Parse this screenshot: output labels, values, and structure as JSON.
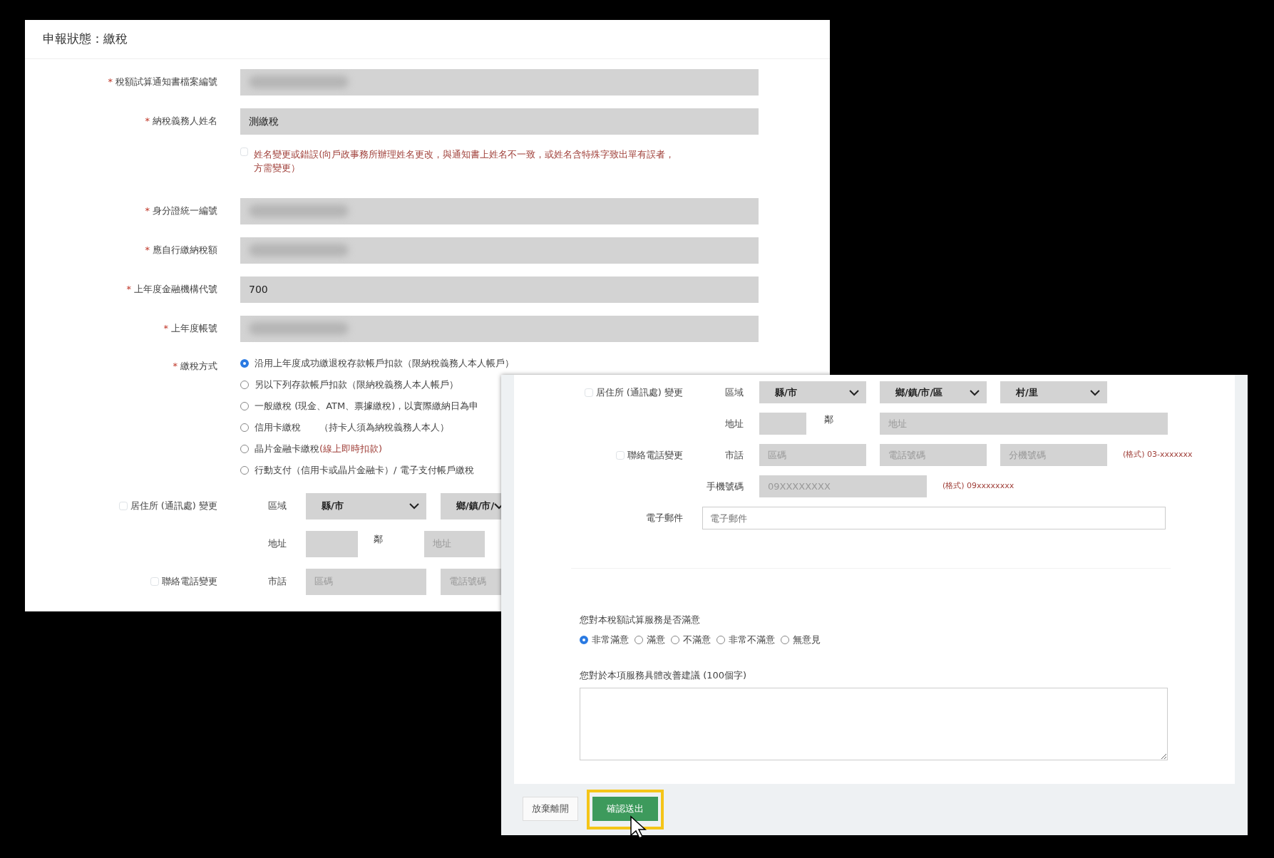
{
  "back_window": {
    "title": "申報狀態：繳稅",
    "fields": [
      {
        "mark": "*",
        "label": "稅額試算通知書檔案編號",
        "kind": "redacted"
      },
      {
        "mark": "*",
        "label": "納稅義務人姓名",
        "kind": "text",
        "value": "測繳稅"
      },
      {
        "kind": "checkbox",
        "label": "姓名變更或錯誤(向戶政事務所辦理姓名更改，與通知書上姓名不一致，或姓名含特殊字致出單有誤者，方需變更）",
        "checked": false
      },
      {
        "mark": "*",
        "label": "身分證統一編號",
        "kind": "redacted"
      },
      {
        "mark": "*",
        "label": "應自行繳納稅額",
        "kind": "redacted"
      },
      {
        "mark": "*",
        "label": "上年度金融機構代號",
        "kind": "text",
        "value": "700"
      },
      {
        "mark": "*",
        "label": "上年度帳號",
        "kind": "redacted"
      }
    ],
    "payment": {
      "mark": "*",
      "label": "繳稅方式",
      "options": [
        {
          "label": "沿用上年度成功繳退稅存款帳戶扣款（限納稅義務人本人帳戶）",
          "selected": true
        },
        {
          "label": "另以下列存款帳戶扣款（限納稅義務人本人帳戶）",
          "selected": false
        },
        {
          "label": "一般繳稅 (現金、ATM、票據繳稅)，以實際繳納日為申",
          "selected": false
        },
        {
          "label": "信用卡繳稅　　（持卡人須為納稅義務人本人）",
          "selected": false
        },
        {
          "label": "晶片金融卡繳稅",
          "note": "(線上即時扣款)",
          "selected": false
        },
        {
          "label": "行動支付（信用卡或晶片金融卡）/ 電子支付帳戶繳稅",
          "selected": false
        }
      ]
    },
    "residence": {
      "label": "居住所 (通訊處) 變更",
      "checked": false,
      "area_label": "區域",
      "selects": [
        "縣/市",
        "鄉/鎮/市/"
      ],
      "address_label": "地址",
      "neighbor": "鄰",
      "address_placeholder": "地址"
    },
    "phone": {
      "label": "聯絡電話變更",
      "checked": false,
      "landline_label": "市話",
      "placeholders": [
        "區碼",
        "電話號碼"
      ]
    }
  },
  "front_window": {
    "residence": {
      "label": "居住所 (通訊處) 變更",
      "checked": false,
      "area_label": "區域",
      "selects": [
        "縣/市",
        "鄉/鎮/市/區",
        "村/里"
      ],
      "address_label": "地址",
      "neighbor": "鄰",
      "address_placeholder": "地址"
    },
    "phone": {
      "label": "聯絡電話變更",
      "checked": false,
      "landline_label": "市話",
      "placeholders": [
        "區碼",
        "電話號碼",
        "分機號碼"
      ],
      "landline_hint": "(格式) 03-xxxxxxx",
      "mobile_label": "手機號碼",
      "mobile_placeholder": "09XXXXXXXX",
      "mobile_hint": "(格式) 09xxxxxxxx"
    },
    "email": {
      "label": "電子郵件",
      "placeholder": "電子郵件"
    },
    "survey": {
      "question": "您對本稅額試算服務是否滿意",
      "options": [
        {
          "label": "非常滿意",
          "selected": true
        },
        {
          "label": "滿意",
          "selected": false
        },
        {
          "label": "不滿意",
          "selected": false
        },
        {
          "label": "非常不滿意",
          "selected": false
        },
        {
          "label": "無意見",
          "selected": false
        }
      ]
    },
    "suggestion": {
      "label": "您對於本項服務具體改善建議 (100個字)"
    },
    "buttons": [
      {
        "label": "放棄離開",
        "kind": "secondary",
        "highlighted": false
      },
      {
        "label": "確認送出",
        "kind": "primary",
        "highlighted": true
      }
    ]
  }
}
